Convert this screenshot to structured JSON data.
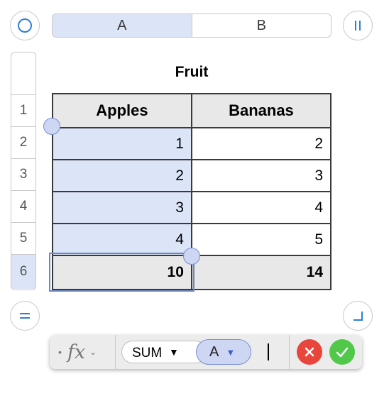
{
  "column_headers": [
    "A",
    "B"
  ],
  "row_headers": [
    "1",
    "2",
    "3",
    "4",
    "5",
    "6"
  ],
  "table": {
    "title": "Fruit",
    "header": [
      "Apples",
      "Bananas"
    ],
    "rows": [
      [
        "1",
        "2"
      ],
      [
        "2",
        "3"
      ],
      [
        "3",
        "4"
      ],
      [
        "4",
        "5"
      ]
    ],
    "totals": [
      "10",
      "14"
    ]
  },
  "formula": {
    "fx_label": "fx",
    "function_token": "SUM",
    "reference_token": "A"
  },
  "colors": {
    "selection": "#dce4f8",
    "handle": "#cdd6f2",
    "accent": "#6c87c8",
    "cancel": "#e8453c",
    "accept": "#52c84a"
  },
  "icons": [
    "circle-icon",
    "pause-icon",
    "equals-icon",
    "corner-icon",
    "cancel-icon",
    "accept-icon"
  ]
}
